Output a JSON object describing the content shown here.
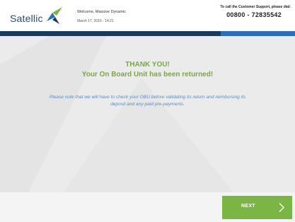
{
  "header": {
    "logo_text": "Satellic",
    "welcome": "Welcome, Massive Dynamic",
    "datetime": "March 17, 2016 - 14:21",
    "support_label": "To call the Customer Support, please dial:",
    "support_phone": "00800 - 72835542"
  },
  "main": {
    "thanks": "THANK YOU!",
    "returned": "Your On Board Unit has been returned!",
    "message": "Please note that we will have to check your OBU before validating its return and reimbursing its deposit and any paid pre-payments."
  },
  "footer": {
    "next_label": "NEXT"
  },
  "colors": {
    "brand_navy": "#1b3a5c",
    "brand_blue": "#2a6fb5",
    "accent_green": "#7bb543",
    "title_green": "#7aa83f",
    "message_blue": "#5a8bc4",
    "content_bg": "#ebebeb"
  },
  "icons": [
    "satellic-logo-icon",
    "chevron-right-icon"
  ]
}
